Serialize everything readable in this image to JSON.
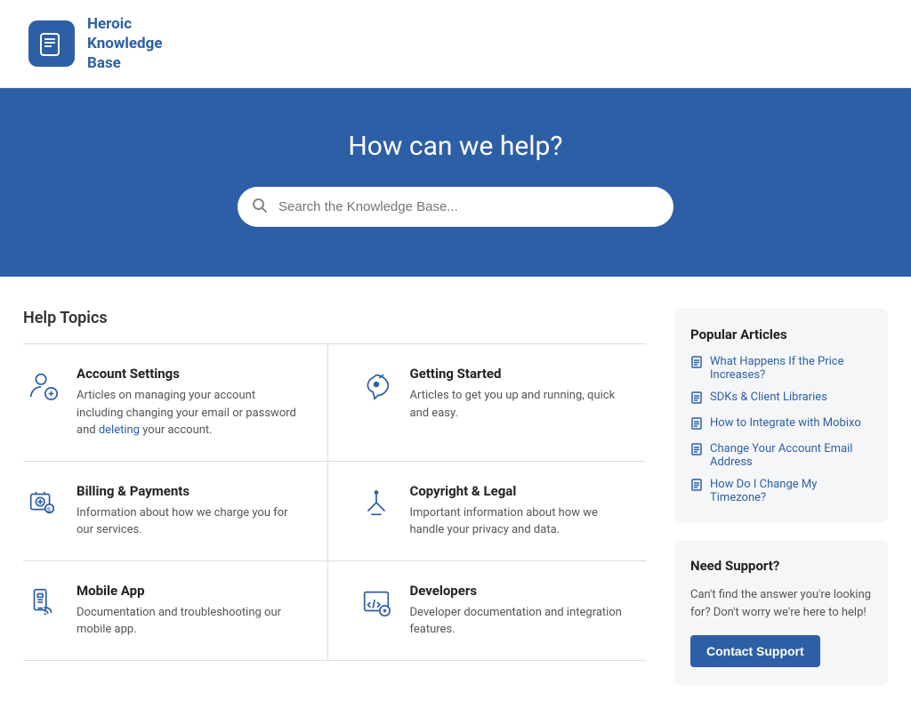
{
  "header": {
    "logo_text": "Heroic\nKnowledge\nBase"
  },
  "hero": {
    "title": "How can we help?",
    "search_placeholder": "Search the Knowledge Base..."
  },
  "help_topics": {
    "section_title": "Help Topics",
    "topics": [
      {
        "name": "Account Settings",
        "desc_parts": [
          "Articles on managing your account including changing your email or password and ",
          "deleting",
          " your account."
        ],
        "icon": "account"
      },
      {
        "name": "Getting Started",
        "desc": "Articles to get you up and running, quick and easy.",
        "icon": "rocket"
      },
      {
        "name": "Billing & Payments",
        "desc_parts": [
          "Information about how we charge you for our services."
        ],
        "icon": "billing"
      },
      {
        "name": "Copyright & Legal",
        "desc": "Important information about how we handle your privacy and data.",
        "icon": "legal"
      },
      {
        "name": "Mobile App",
        "desc": "Documentation and troubleshooting our mobile app.",
        "icon": "mobile"
      },
      {
        "name": "Developers",
        "desc": "Developer documentation and integration features.",
        "icon": "developers"
      }
    ]
  },
  "sidebar": {
    "popular_articles": {
      "title": "Popular Articles",
      "articles": [
        "What Happens If the Price Increases?",
        "SDKs & Client Libraries",
        "How to Integrate with Mobixo",
        "Change Your Account Email Address",
        "How Do I Change My Timezone?"
      ]
    },
    "need_support": {
      "title": "Need Support?",
      "desc": "Can't find the answer you're looking for? Don't worry we're here to help!",
      "button_label": "Contact Support"
    }
  }
}
